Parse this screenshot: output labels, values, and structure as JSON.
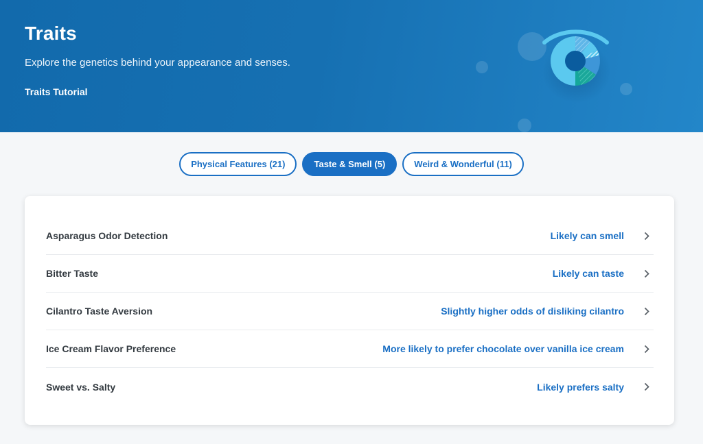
{
  "header": {
    "title": "Traits",
    "subtitle": "Explore the genetics behind your appearance and senses.",
    "tutorial_link": "Traits Tutorial",
    "illustration_icon": "eye-donut-chart-icon"
  },
  "tabs": [
    {
      "label": "Physical Features (21)",
      "active": false
    },
    {
      "label": "Taste & Smell (5)",
      "active": true
    },
    {
      "label": "Weird & Wonderful (11)",
      "active": false
    }
  ],
  "traits": [
    {
      "name": "Asparagus Odor Detection",
      "result": "Likely can smell"
    },
    {
      "name": "Bitter Taste",
      "result": "Likely can taste"
    },
    {
      "name": "Cilantro Taste Aversion",
      "result": "Slightly higher odds of disliking cilantro"
    },
    {
      "name": "Ice Cream Flavor Preference",
      "result": "More likely to prefer chocolate over vanilla ice cream"
    },
    {
      "name": "Sweet vs. Salty",
      "result": "Likely prefers salty"
    }
  ],
  "colors": {
    "brand_blue": "#1a6fc4",
    "hero_blue": "#126aac",
    "text_dark": "#333a40",
    "background": "#f5f7f9"
  }
}
